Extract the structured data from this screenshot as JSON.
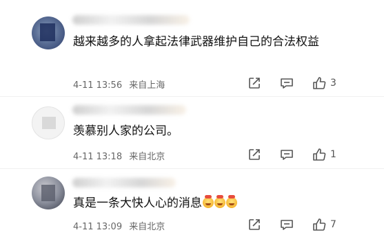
{
  "comments": [
    {
      "text": "越来越多的人拿起法律武器维护自己的合法权益",
      "time": "4-11 13:56",
      "location": "来自上海",
      "likes": "3"
    },
    {
      "text": "羡慕别人家的公司。",
      "time": "4-11 13:18",
      "location": "来自北京",
      "likes": "1"
    },
    {
      "text": "真是一条大快人心的消息",
      "time": "4-11 13:09",
      "location": "来自北京",
      "likes": "7",
      "emoji": [
        "blushing-smile-emoji",
        "blushing-smile-emoji",
        "blushing-smile-emoji"
      ]
    }
  ],
  "icons": {
    "share": "share-icon",
    "reply": "comment-icon",
    "like": "thumbs-up-icon"
  }
}
